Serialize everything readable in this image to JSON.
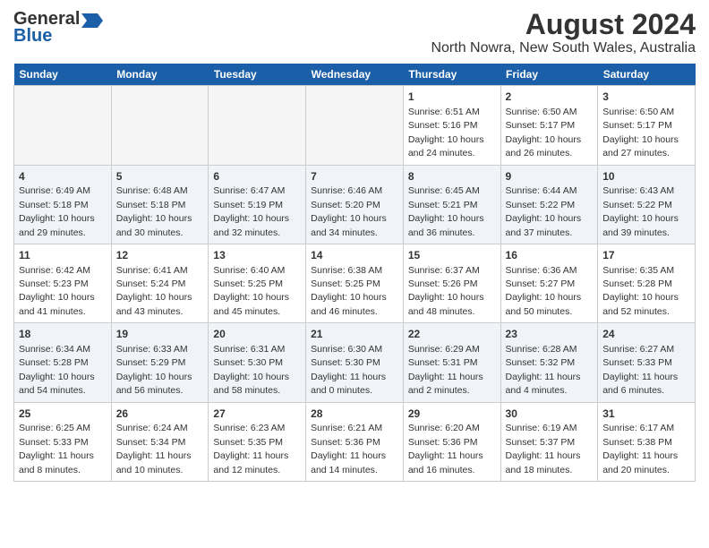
{
  "header": {
    "title": "August 2024",
    "subtitle": "North Nowra, New South Wales, Australia",
    "logo_general": "General",
    "logo_blue": "Blue"
  },
  "days_of_week": [
    "Sunday",
    "Monday",
    "Tuesday",
    "Wednesday",
    "Thursday",
    "Friday",
    "Saturday"
  ],
  "rows": [
    {
      "cells": [
        {
          "date": "",
          "info": "",
          "empty": true
        },
        {
          "date": "",
          "info": "",
          "empty": true
        },
        {
          "date": "",
          "info": "",
          "empty": true
        },
        {
          "date": "",
          "info": "",
          "empty": true
        },
        {
          "date": "1",
          "info": "Sunrise: 6:51 AM\nSunset: 5:16 PM\nDaylight: 10 hours and 24 minutes.",
          "empty": false
        },
        {
          "date": "2",
          "info": "Sunrise: 6:50 AM\nSunset: 5:17 PM\nDaylight: 10 hours and 26 minutes.",
          "empty": false
        },
        {
          "date": "3",
          "info": "Sunrise: 6:50 AM\nSunset: 5:17 PM\nDaylight: 10 hours and 27 minutes.",
          "empty": false
        }
      ]
    },
    {
      "cells": [
        {
          "date": "4",
          "info": "Sunrise: 6:49 AM\nSunset: 5:18 PM\nDaylight: 10 hours and 29 minutes.",
          "empty": false
        },
        {
          "date": "5",
          "info": "Sunrise: 6:48 AM\nSunset: 5:18 PM\nDaylight: 10 hours and 30 minutes.",
          "empty": false
        },
        {
          "date": "6",
          "info": "Sunrise: 6:47 AM\nSunset: 5:19 PM\nDaylight: 10 hours and 32 minutes.",
          "empty": false
        },
        {
          "date": "7",
          "info": "Sunrise: 6:46 AM\nSunset: 5:20 PM\nDaylight: 10 hours and 34 minutes.",
          "empty": false
        },
        {
          "date": "8",
          "info": "Sunrise: 6:45 AM\nSunset: 5:21 PM\nDaylight: 10 hours and 36 minutes.",
          "empty": false
        },
        {
          "date": "9",
          "info": "Sunrise: 6:44 AM\nSunset: 5:22 PM\nDaylight: 10 hours and 37 minutes.",
          "empty": false
        },
        {
          "date": "10",
          "info": "Sunrise: 6:43 AM\nSunset: 5:22 PM\nDaylight: 10 hours and 39 minutes.",
          "empty": false
        }
      ]
    },
    {
      "cells": [
        {
          "date": "11",
          "info": "Sunrise: 6:42 AM\nSunset: 5:23 PM\nDaylight: 10 hours and 41 minutes.",
          "empty": false
        },
        {
          "date": "12",
          "info": "Sunrise: 6:41 AM\nSunset: 5:24 PM\nDaylight: 10 hours and 43 minutes.",
          "empty": false
        },
        {
          "date": "13",
          "info": "Sunrise: 6:40 AM\nSunset: 5:25 PM\nDaylight: 10 hours and 45 minutes.",
          "empty": false
        },
        {
          "date": "14",
          "info": "Sunrise: 6:38 AM\nSunset: 5:25 PM\nDaylight: 10 hours and 46 minutes.",
          "empty": false
        },
        {
          "date": "15",
          "info": "Sunrise: 6:37 AM\nSunset: 5:26 PM\nDaylight: 10 hours and 48 minutes.",
          "empty": false
        },
        {
          "date": "16",
          "info": "Sunrise: 6:36 AM\nSunset: 5:27 PM\nDaylight: 10 hours and 50 minutes.",
          "empty": false
        },
        {
          "date": "17",
          "info": "Sunrise: 6:35 AM\nSunset: 5:28 PM\nDaylight: 10 hours and 52 minutes.",
          "empty": false
        }
      ]
    },
    {
      "cells": [
        {
          "date": "18",
          "info": "Sunrise: 6:34 AM\nSunset: 5:28 PM\nDaylight: 10 hours and 54 minutes.",
          "empty": false
        },
        {
          "date": "19",
          "info": "Sunrise: 6:33 AM\nSunset: 5:29 PM\nDaylight: 10 hours and 56 minutes.",
          "empty": false
        },
        {
          "date": "20",
          "info": "Sunrise: 6:31 AM\nSunset: 5:30 PM\nDaylight: 10 hours and 58 minutes.",
          "empty": false
        },
        {
          "date": "21",
          "info": "Sunrise: 6:30 AM\nSunset: 5:30 PM\nDaylight: 11 hours and 0 minutes.",
          "empty": false
        },
        {
          "date": "22",
          "info": "Sunrise: 6:29 AM\nSunset: 5:31 PM\nDaylight: 11 hours and 2 minutes.",
          "empty": false
        },
        {
          "date": "23",
          "info": "Sunrise: 6:28 AM\nSunset: 5:32 PM\nDaylight: 11 hours and 4 minutes.",
          "empty": false
        },
        {
          "date": "24",
          "info": "Sunrise: 6:27 AM\nSunset: 5:33 PM\nDaylight: 11 hours and 6 minutes.",
          "empty": false
        }
      ]
    },
    {
      "cells": [
        {
          "date": "25",
          "info": "Sunrise: 6:25 AM\nSunset: 5:33 PM\nDaylight: 11 hours and 8 minutes.",
          "empty": false
        },
        {
          "date": "26",
          "info": "Sunrise: 6:24 AM\nSunset: 5:34 PM\nDaylight: 11 hours and 10 minutes.",
          "empty": false
        },
        {
          "date": "27",
          "info": "Sunrise: 6:23 AM\nSunset: 5:35 PM\nDaylight: 11 hours and 12 minutes.",
          "empty": false
        },
        {
          "date": "28",
          "info": "Sunrise: 6:21 AM\nSunset: 5:36 PM\nDaylight: 11 hours and 14 minutes.",
          "empty": false
        },
        {
          "date": "29",
          "info": "Sunrise: 6:20 AM\nSunset: 5:36 PM\nDaylight: 11 hours and 16 minutes.",
          "empty": false
        },
        {
          "date": "30",
          "info": "Sunrise: 6:19 AM\nSunset: 5:37 PM\nDaylight: 11 hours and 18 minutes.",
          "empty": false
        },
        {
          "date": "31",
          "info": "Sunrise: 6:17 AM\nSunset: 5:38 PM\nDaylight: 11 hours and 20 minutes.",
          "empty": false
        }
      ]
    }
  ]
}
